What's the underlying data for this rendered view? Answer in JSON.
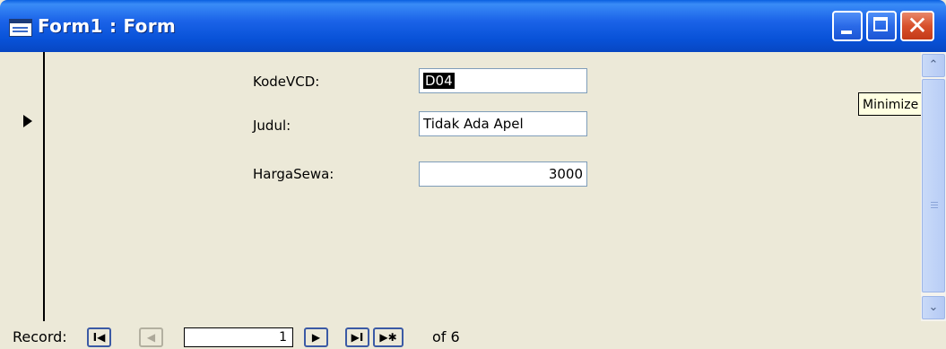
{
  "window": {
    "title": "Form1 : Form"
  },
  "form": {
    "kode_label": "KodeVCD:",
    "kode_value": "D04",
    "judul_label": "Judul:",
    "judul_value": "Tidak Ada Apel",
    "harga_label": "HargaSewa:",
    "harga_value": "3000"
  },
  "tooltip": {
    "text": "Minimize"
  },
  "nav": {
    "record_label": "Record:",
    "first_icon": "I◀",
    "prev_icon": "◀",
    "current": "1",
    "next_icon": "▶",
    "last_icon": "▶I",
    "new_icon": "▶✱",
    "of_label": "of",
    "total": "6"
  },
  "colors": {
    "titlebar": "#0a5fe0",
    "window_bg": "#ece9d8",
    "close_button": "#d8502c",
    "tooltip_bg": "#ffffe1"
  },
  "icons": {
    "app": "form-icon",
    "minimize": "minimize-icon",
    "maximize": "maximize-icon",
    "close": "close-icon"
  }
}
